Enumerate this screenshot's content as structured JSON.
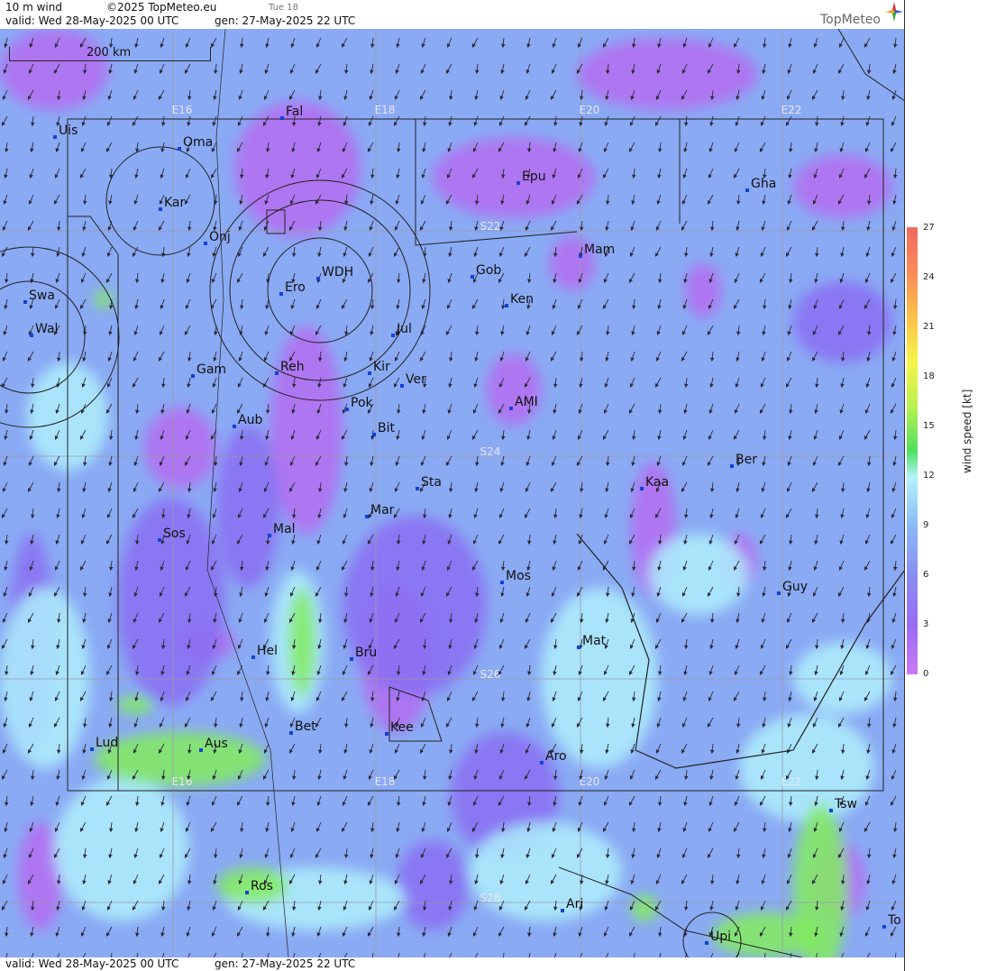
{
  "header": {
    "title": "10 m wind",
    "copyright": "©2025 TopMeteo.eu",
    "day_label": "Tue 18",
    "valid": "valid:  Wed  28-May-2025  00 UTC",
    "gen": "gen: 27-May-2025 22 UTC",
    "logo": "TopMeteo"
  },
  "footer": {
    "valid": "valid:  Wed  28-May-2025  00 UTC",
    "gen": "gen: 27-May-2025 22 UTC"
  },
  "scale_label": "200 km",
  "grid_labels": {
    "lon": [
      "E16",
      "E18",
      "E20",
      "E22"
    ],
    "lat": [
      "S22",
      "S24",
      "S26",
      "S28"
    ]
  },
  "places": [
    "Uis",
    "Oma",
    "Fal",
    "Kar",
    "Onj",
    "Epu",
    "Gha",
    "Mam",
    "Gob",
    "WDH",
    "Ero",
    "Ken",
    "Swa",
    "Wal",
    "Jul",
    "Gam",
    "Reh",
    "Kir",
    "Ver",
    "AMI",
    "Pok",
    "Bit",
    "Aub",
    "Ber",
    "Kaa",
    "Sta",
    "Mar",
    "Sos",
    "Mal",
    "Mos",
    "Guy",
    "Mat",
    "Hel",
    "Bru",
    "Bet",
    "Kee",
    "Lud",
    "Aus",
    "Aro",
    "Tsw",
    "Ros",
    "Ari",
    "To",
    "Upi"
  ],
  "legend": {
    "title": "wind speed [kt]",
    "ticks": [
      "27",
      "24",
      "21",
      "18",
      "15",
      "12",
      "9",
      "6",
      "3",
      "0"
    ],
    "colors": [
      "#b56cf0",
      "#8a5cf0",
      "#8aa8f2",
      "#a9eefc",
      "#58e05a",
      "#c8f24a",
      "#f7f44a",
      "#fbb84a",
      "#f57a60"
    ]
  },
  "map_colors": {
    "purple": "#b56cf0",
    "violet": "#8a6ef2",
    "blue": "#8aaaf4",
    "cyan": "#aeeffc",
    "green": "#82ec5e",
    "border": "#222222",
    "grid": "#9a9aa8"
  }
}
